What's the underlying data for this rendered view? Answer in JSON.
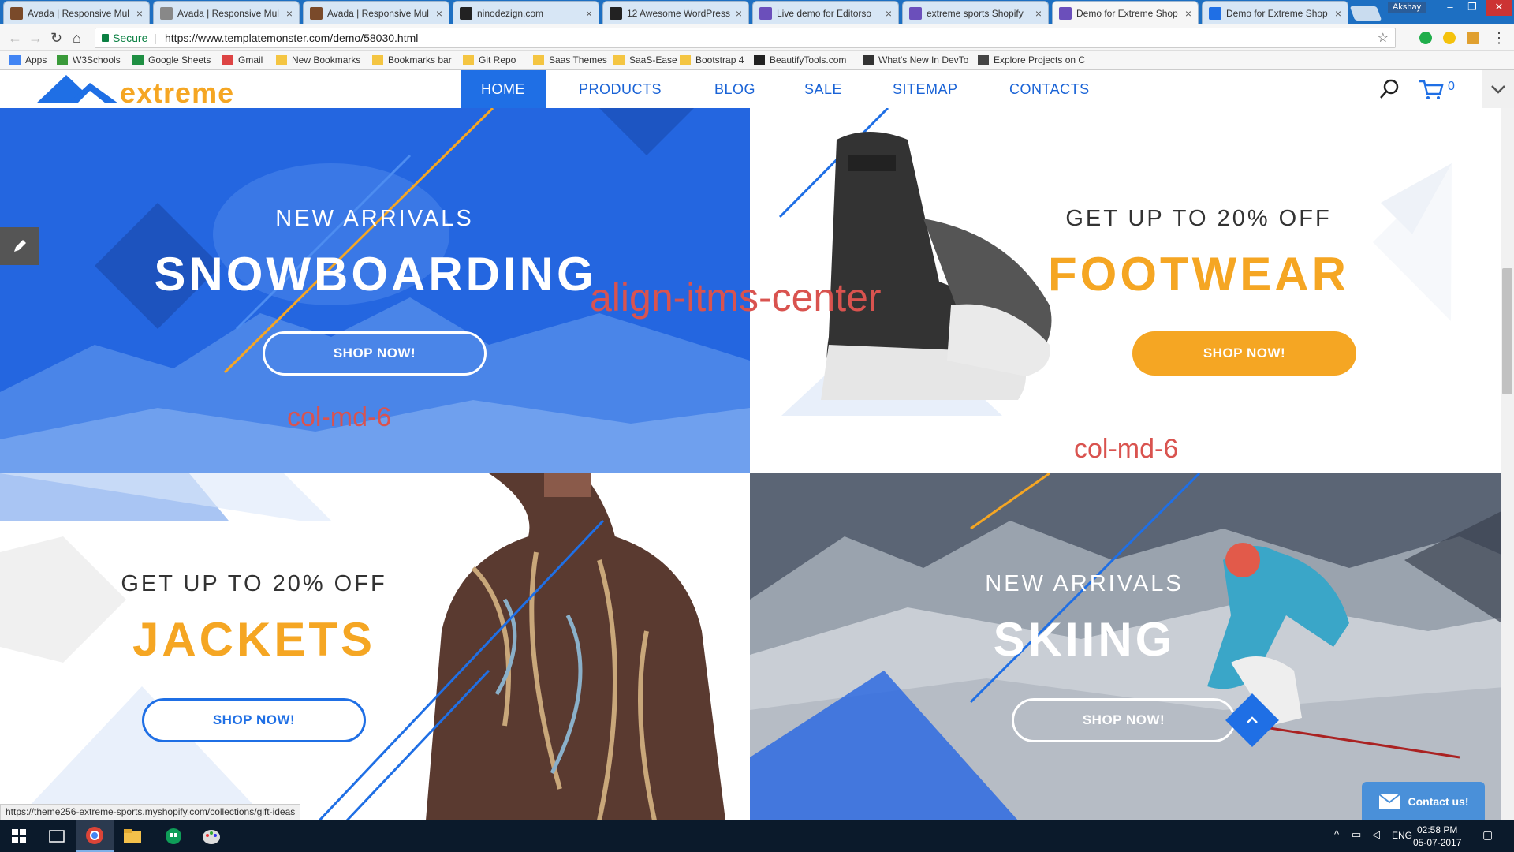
{
  "browser": {
    "tabs": [
      {
        "title": "Avada | Responsive Mul",
        "color": "#7a4a2a"
      },
      {
        "title": "Avada | Responsive Mul",
        "color": "#888888"
      },
      {
        "title": "Avada | Responsive Mul",
        "color": "#7a4a2a"
      },
      {
        "title": "ninodezign.com",
        "color": "#222222"
      },
      {
        "title": "12 Awesome WordPress",
        "color": "#222222"
      },
      {
        "title": "Live demo for Editorso",
        "color": "#6b4fbb"
      },
      {
        "title": "extreme sports Shopify",
        "color": "#6b4fbb"
      },
      {
        "title": "Demo for Extreme Shop",
        "color": "#6b4fbb",
        "active": true
      },
      {
        "title": "Demo for Extreme Shop",
        "color": "#1f6fe5"
      }
    ],
    "close_glyph": "×",
    "user": "Akshay",
    "secure_label": "Secure",
    "url": "https://www.templatemonster.com/demo/58030.html",
    "bookmarks": [
      "Apps",
      "W3Schools",
      "Google Sheets",
      "Gmail",
      "New Bookmarks",
      "Bookmarks bar",
      "Git Repo",
      "Saas Themes",
      "SaaS-Ease",
      "Bootstrap 4",
      "BeautifyTools.com",
      "What's New In DevTo",
      "Explore Projects on C"
    ],
    "status_url": "https://theme256-extreme-sports.myshopify.com/collections/gift-ideas"
  },
  "site": {
    "logo": "extreme",
    "nav": [
      "HOME",
      "PRODUCTS",
      "BLOG",
      "SALE",
      "SITEMAP",
      "CONTACTS"
    ],
    "cart_count": "0",
    "accent": "#1f6fe5",
    "orange": "#f5a623"
  },
  "banners": [
    {
      "pretitle": "NEW ARRIVALS",
      "title": "SNOWBOARDING",
      "button": "SHOP NOW!"
    },
    {
      "pretitle": "GET UP TO 20% OFF",
      "title": "FOOTWEAR",
      "button": "SHOP NOW!"
    },
    {
      "pretitle": "GET UP TO 20% OFF",
      "title": "JACKETS",
      "button": "SHOP NOW!"
    },
    {
      "pretitle": "NEW ARRIVALS",
      "title": "SKIING",
      "button": "SHOP NOW!"
    }
  ],
  "annotations": {
    "center": "align-itms-center",
    "col_left": "col-md-6",
    "col_right": "col-md-6"
  },
  "contact_button": "Contact us!",
  "taskbar": {
    "lang": "ENG",
    "time": "02:58 PM",
    "date": "05-07-2017"
  }
}
